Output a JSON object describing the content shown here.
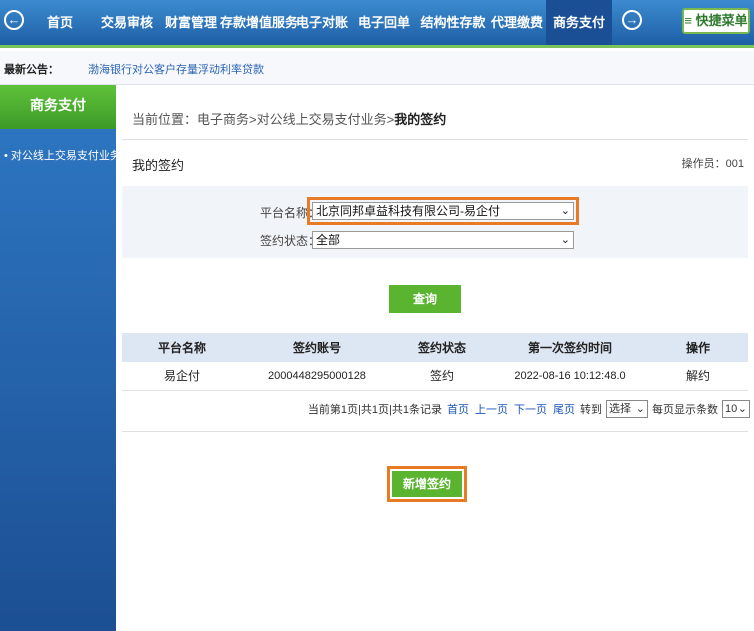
{
  "nav": {
    "items": [
      "首页",
      "交易审核",
      "财富管理",
      "存款增值服务",
      "电子对账",
      "电子回单",
      "结构性存款",
      "代理缴费",
      "商务支付"
    ],
    "quick_menu": "≡ 快捷菜单"
  },
  "notice": {
    "label": "最新公告：",
    "text": "渤海银行对公客户存量浮动利率贷款"
  },
  "sidebar": {
    "title": "商务支付",
    "items": [
      "• 对公线上交易支付业务 •"
    ]
  },
  "main": {
    "breadcrumb_prefix": "当前位置：电子商务>对公线上交易支付业务>",
    "breadcrumb_current": "我的签约",
    "section_title": "我的签约",
    "operator": "操作员：001",
    "form": {
      "platform_label": "平台名称：",
      "platform_value": "北京同邦卓益科技有限公司-易企付",
      "status_label": "签约状态：",
      "status_value": "全部",
      "query_button": "查询"
    },
    "table": {
      "headers": [
        "平台名称",
        "签约账号",
        "签约状态",
        "第一次签约时间",
        "操作"
      ],
      "rows": [
        [
          "易企付",
          "2000448295000128",
          "签约",
          "2022-08-16 10:12:48.0",
          "解约"
        ]
      ]
    },
    "pager": {
      "info": "当前第1页|共1页|共1条记录",
      "first": "首页",
      "prev": "上一页",
      "next": "下一页",
      "last": "尾页",
      "goto": "转到",
      "goto_value": "选择",
      "per_page_label": "每页显示条数",
      "per_page_value": "10"
    },
    "add_button": "新增签约"
  },
  "colors": {
    "nav_blue": "#1f5fa6",
    "accent_green": "#5ab42f",
    "highlight_orange": "#ea7b25"
  }
}
